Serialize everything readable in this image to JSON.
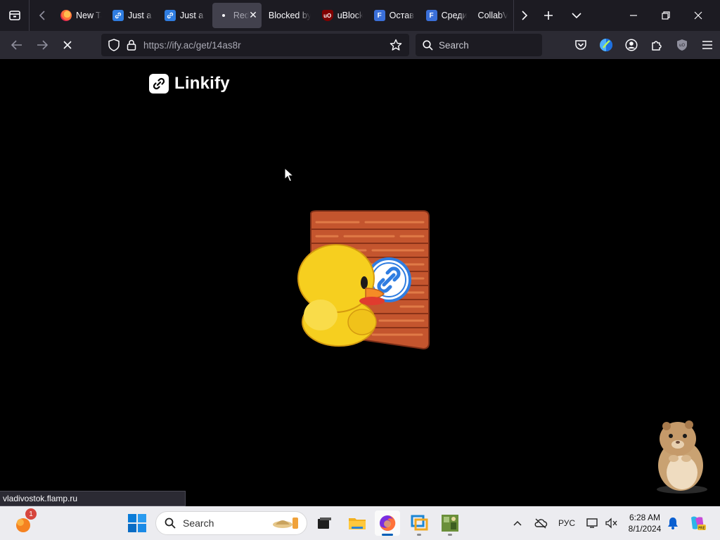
{
  "browser": {
    "tabs": [
      {
        "label": "New Tab",
        "favicon": "firefox-icon"
      },
      {
        "label": "Just a moment...",
        "favicon": "linkify-icon"
      },
      {
        "label": "Just a moment...",
        "favicon": "linkify-icon"
      },
      {
        "label": "Redirecting",
        "favicon": "loading-dot-icon",
        "active": true
      },
      {
        "label": "Blocked by",
        "favicon": "none"
      },
      {
        "label": "uBlock",
        "favicon": "ublock-icon"
      },
      {
        "label": "Оставить",
        "favicon": "flamp-icon"
      },
      {
        "label": "Среди",
        "favicon": "flamp-icon"
      },
      {
        "label": "CollabVM",
        "favicon": "none"
      }
    ],
    "url_host": "https://ify.ac",
    "url_path": "/get/14as8r",
    "search_placeholder": "Search",
    "status_link": "vladivostok.flamp.ru"
  },
  "page": {
    "brand_name": "Linkify"
  },
  "taskbar": {
    "notification_count": "1",
    "search_placeholder": "Search",
    "language": "РУС",
    "time": "6:28 AM",
    "date": "8/1/2024"
  },
  "colors": {
    "tab_strip_bg": "#1c1b22",
    "nav_bg": "#2b2a33",
    "active_tab_bg": "#42414d",
    "page_bg": "#000000",
    "brick": "#c4552e",
    "duck": "#f6cf1f",
    "link_blue": "#2f7de1",
    "taskbar_bg": "#ececf0"
  }
}
